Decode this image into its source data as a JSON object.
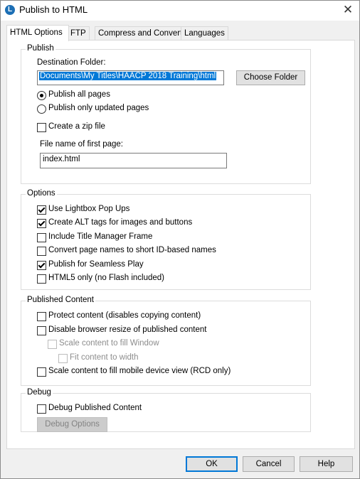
{
  "window": {
    "title": "Publish to HTML",
    "icon": "app-logo-icon"
  },
  "tabs": [
    {
      "label": "HTML Options"
    },
    {
      "label": "FTP"
    },
    {
      "label": "Compress and Convert"
    },
    {
      "label": "Languages"
    }
  ],
  "publish": {
    "group_label": "Publish",
    "destination_label": "Destination Folder:",
    "destination_value": "Documents\\My Titles\\HAACP 2018 Training\\html",
    "choose_folder": "Choose Folder",
    "radio_all": "Publish all pages",
    "radio_updated": "Publish only updated pages",
    "selected": "all",
    "zip_label": "Create a zip file",
    "zip_checked": false,
    "first_page_label": "File name of first page:",
    "first_page_value": "index.html"
  },
  "options": {
    "group_label": "Options",
    "items": [
      {
        "label": "Use Lightbox Pop Ups",
        "checked": true
      },
      {
        "label": "Create ALT tags for images and buttons",
        "checked": true
      },
      {
        "label": "Include Title Manager Frame",
        "checked": false
      },
      {
        "label": "Convert page names to short ID-based names",
        "checked": false
      },
      {
        "label": "Publish for Seamless Play",
        "checked": true
      },
      {
        "label": "HTML5 only (no Flash included)",
        "checked": false
      }
    ]
  },
  "published_content": {
    "group_label": "Published Content",
    "protect": "Protect content (disables copying content)",
    "disable_resize": "Disable browser resize of published content",
    "scale_window": "Scale content to fill Window",
    "fit_width": "Fit content to width",
    "scale_mobile": "Scale content to fill mobile device view (RCD only)"
  },
  "debug": {
    "group_label": "Debug",
    "debug_published": "Debug Published Content",
    "debug_options": "Debug Options"
  },
  "footer": {
    "ok": "OK",
    "cancel": "Cancel",
    "help": "Help"
  }
}
